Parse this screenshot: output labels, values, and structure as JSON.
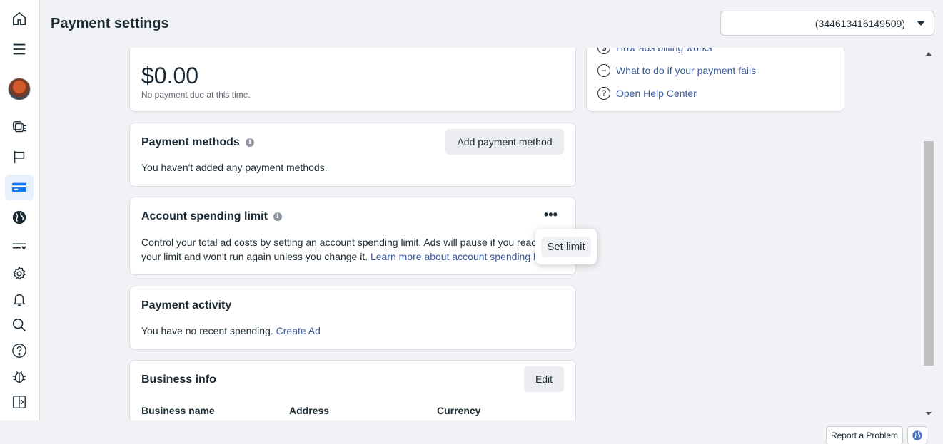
{
  "header": {
    "title": "Payment settings",
    "account_id": "(344613416149509)"
  },
  "rail": {
    "icons": [
      "home-icon",
      "menu-icon",
      "avatar",
      "ads-manager-icon",
      "flag-icon",
      "billing-icon",
      "globe-icon",
      "events-icon",
      "settings-icon",
      "notifications-icon",
      "search-icon",
      "help-icon",
      "bug-icon",
      "collapse-icon"
    ]
  },
  "balance": {
    "amount": "$0.00",
    "note": "No payment due at this time."
  },
  "help": {
    "links": [
      "How ads billing works",
      "What to do if your payment fails",
      "Open Help Center"
    ]
  },
  "payment_methods": {
    "title": "Payment methods",
    "add_label": "Add payment method",
    "empty_text": "You haven't added any payment methods."
  },
  "spending_limit": {
    "title": "Account spending limit",
    "line1": "Control your total ad costs by setting an account spending limit. Ads will pause if you reac",
    "line2_prefix": "your limit and won't run again unless you change it. ",
    "learn_more": "Learn more about account spending li",
    "more": "•••",
    "popover_label": "Set limit"
  },
  "payment_activity": {
    "title": "Payment activity",
    "text": "You have no recent spending. ",
    "create_ad": "Create Ad"
  },
  "business_info": {
    "title": "Business info",
    "edit_label": "Edit",
    "columns": [
      "Business name",
      "Address",
      "Currency"
    ]
  },
  "footer": {
    "report": "Report a Problem"
  }
}
